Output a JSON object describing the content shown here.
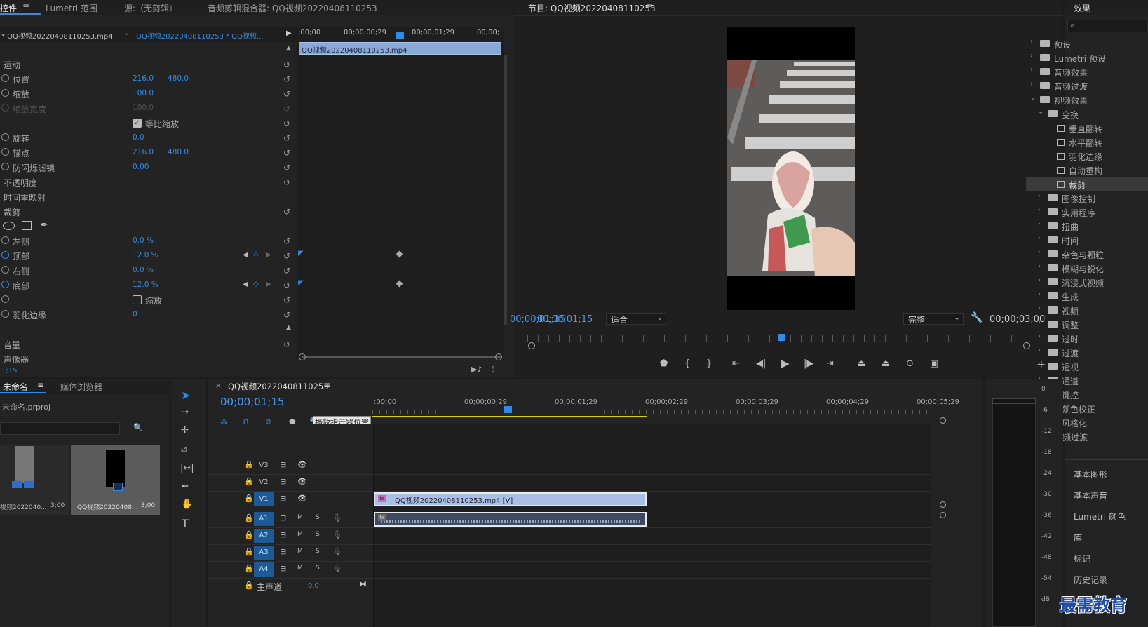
{
  "effect_controls": {
    "tabs": [
      "控件",
      "Lumetri 范围",
      "源:（无剪辑）",
      "音频剪辑混合器: QQ视频20220408110253"
    ],
    "source_clip": "* QQ视频20220408110253.mp4",
    "seq_clip": "QQ视频20220408110253 * QQ视频...",
    "timecodes": [
      ";00;00",
      "00;00;00;29",
      "00;00;01;29",
      "00;00;"
    ],
    "clip_bar": "QQ视频20220408110253.mp4",
    "motion": {
      "header": "运动",
      "position": {
        "label": "位置",
        "x": "216.0",
        "y": "480.0"
      },
      "scale": {
        "label": "缩放",
        "value": "100.0"
      },
      "scale_width": {
        "label": "缩放宽度",
        "value": "100.0"
      },
      "uniform": "等比缩放",
      "rotation": {
        "label": "旋转",
        "value": "0.0"
      },
      "anchor": {
        "label": "锚点",
        "x": "216.0",
        "y": "480.0"
      },
      "flicker": {
        "label": "防闪烁滤镜",
        "value": "0.00"
      }
    },
    "opacity": "不透明度",
    "time_remap": "时间重映射",
    "crop": {
      "header": "裁剪",
      "left": {
        "label": "左侧",
        "value": "0.0 %"
      },
      "top": {
        "label": "顶部",
        "value": "12.0 %"
      },
      "right": {
        "label": "右侧",
        "value": "0.0 %"
      },
      "bottom": {
        "label": "底部",
        "value": "12.0 %"
      },
      "zoom": "缩放",
      "feather": {
        "label": "羽化边缘",
        "value": "0"
      }
    },
    "volume": "音量",
    "panner": "声像器",
    "footer_time": "1;15"
  },
  "program": {
    "title": "节目: QQ视频20220408110253",
    "timecode": "00;00;01;15",
    "fit": "适合",
    "quality": "完整",
    "duration": "00;00;03;00"
  },
  "effects": {
    "title": "效果",
    "items": [
      {
        "label": "预设"
      },
      {
        "label": "Lumetri 预设"
      },
      {
        "label": "音频效果"
      },
      {
        "label": "音频过渡"
      },
      {
        "label": "视频效果"
      },
      {
        "label": "变换"
      },
      {
        "label": "垂直翻转"
      },
      {
        "label": "水平翻转"
      },
      {
        "label": "羽化边缘"
      },
      {
        "label": "自动重构"
      },
      {
        "label": "裁剪"
      },
      {
        "label": "图像控制"
      },
      {
        "label": "实用程序"
      },
      {
        "label": "扭曲"
      },
      {
        "label": "时间"
      },
      {
        "label": "杂色与颗粒"
      },
      {
        "label": "模糊与锐化"
      },
      {
        "label": "沉浸式视频"
      },
      {
        "label": "生成"
      },
      {
        "label": "视频"
      },
      {
        "label": "调整"
      },
      {
        "label": "过时"
      },
      {
        "label": "过渡"
      },
      {
        "label": "透视"
      },
      {
        "label": "通道"
      },
      {
        "label": "键控"
      },
      {
        "label": "颜色校正"
      },
      {
        "label": "风格化"
      },
      {
        "label": "视频过渡"
      }
    ],
    "panels": [
      "基本图形",
      "基本声音",
      "Lumetri 颜色",
      "库",
      "标记",
      "历史记录"
    ]
  },
  "project": {
    "tabs": [
      "未命名",
      "媒体浏览器"
    ],
    "file": "未命名.prproj",
    "items": [
      {
        "name": "视频2022040...",
        "duration": "3;00"
      },
      {
        "name": "QQ视频20220408...",
        "duration": "3;00"
      }
    ]
  },
  "timeline": {
    "title": "QQ视频20220408110253",
    "timecode": "00;00;01;15",
    "tooltip": "播放指示器位置",
    "ruler": [
      ":00;00",
      "00;00;00;29",
      "00;00;01;29",
      "00;00;02;29",
      "00;00;03;29",
      "00;00;04;29",
      "00;00;05;29"
    ],
    "tracks_v": [
      "V3",
      "V2",
      "V1"
    ],
    "tracks_a": [
      "A1",
      "A2",
      "A3",
      "A4"
    ],
    "master": "主声道",
    "master_value": "0.0",
    "video_clip": "QQ视频20220408110253.mp4 [V]",
    "ms": [
      "M",
      "S"
    ]
  },
  "meter": {
    "scale": [
      "0",
      "-6",
      "-12",
      "-18",
      "-24",
      "-30",
      "-36",
      "-42",
      "-48",
      "-54",
      "dB"
    ]
  },
  "watermark": "最需教育"
}
